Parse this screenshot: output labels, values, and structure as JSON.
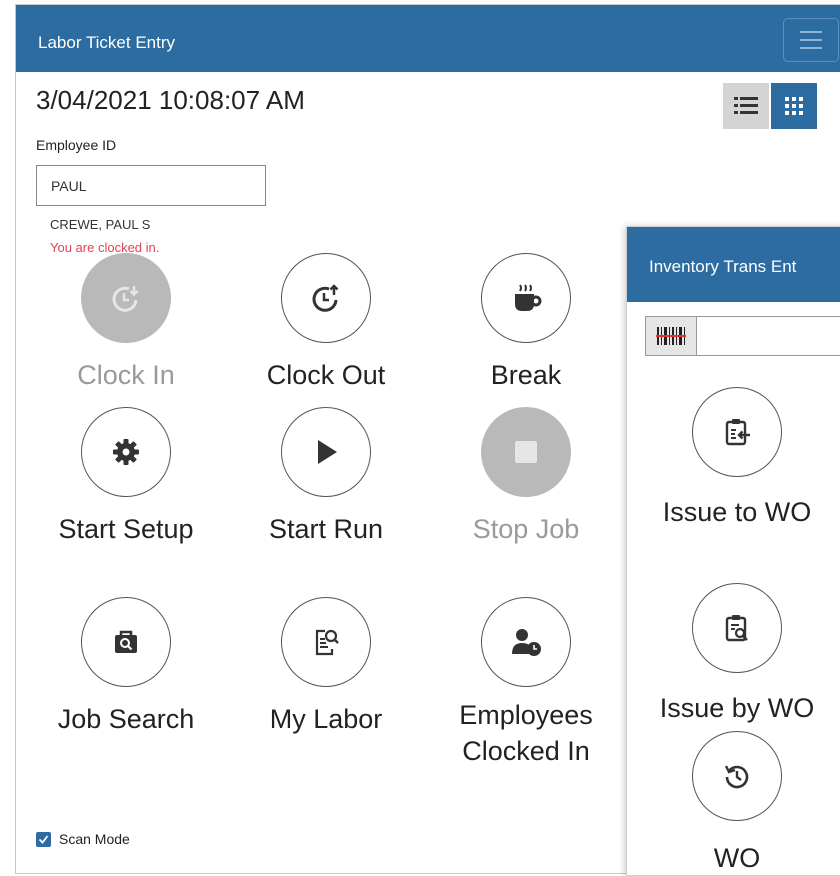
{
  "labor_window": {
    "title": "Labor Ticket Entry",
    "datetime": "3/04/2021 10:08:07 AM",
    "employee_id_label": "Employee ID",
    "employee_id_value": "PAUL",
    "employee_name": "CREWE, PAUL S",
    "status_text": "You are clocked in.",
    "actions": {
      "clock_in": "Clock In",
      "clock_out": "Clock Out",
      "break": "Break",
      "start_setup": "Start Setup",
      "start_run": "Start Run",
      "stop_job": "Stop Job",
      "job_search": "Job Search",
      "my_labor": "My Labor",
      "employees_clocked_in_line1": "Employees",
      "employees_clocked_in_line2": "Clocked In"
    },
    "scan_mode_label": "Scan Mode"
  },
  "inventory_window": {
    "title": "Inventory Trans Ent",
    "actions": {
      "issue_to_wo": "Issue to WO",
      "issue_by_wo": "Issue by WO",
      "wo_partial": "WO"
    }
  },
  "colors": {
    "accent": "#2c6ca0",
    "status_red": "#e0454f",
    "disabled_gray": "#b9b9b9"
  },
  "icons": [
    "menu-icon",
    "list-view-icon",
    "grid-view-icon",
    "clock-in-icon",
    "clock-out-icon",
    "coffee-icon",
    "gear-icon",
    "play-icon",
    "stop-icon",
    "briefcase-search-icon",
    "document-search-icon",
    "user-clock-icon",
    "checkbox-checked-icon",
    "barcode-icon",
    "clipboard-import-icon",
    "clipboard-search-icon",
    "history-icon"
  ]
}
